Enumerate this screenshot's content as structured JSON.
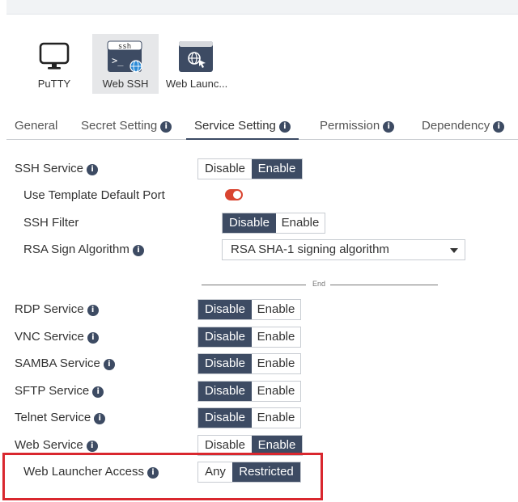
{
  "apps": [
    {
      "label": "PuTTY",
      "icon": "monitor-icon",
      "active": false
    },
    {
      "label": "Web SSH",
      "icon": "ssh-terminal-icon",
      "icon_text": "ssh",
      "active": true
    },
    {
      "label": "Web Launc...",
      "icon": "web-launcher-icon",
      "active": false
    }
  ],
  "tabs": [
    {
      "label": "General",
      "info": false,
      "active": false
    },
    {
      "label": "Secret Setting",
      "info": true,
      "active": false
    },
    {
      "label": "Service Setting",
      "info": true,
      "active": true
    },
    {
      "label": "Permission",
      "info": true,
      "active": false
    },
    {
      "label": "Dependency",
      "info": true,
      "active": false
    }
  ],
  "ssh": {
    "label": "SSH Service",
    "options": [
      "Disable",
      "Enable"
    ],
    "selected": "Enable",
    "template_port": {
      "label": "Use Template Default Port",
      "on": true
    },
    "filter": {
      "label": "SSH Filter",
      "options": [
        "Disable",
        "Enable"
      ],
      "selected": "Disable"
    },
    "rsa": {
      "label": "RSA Sign Algorithm",
      "value": "RSA SHA-1 signing algorithm"
    }
  },
  "divider": "End",
  "services": [
    {
      "label": "RDP Service",
      "options": [
        "Disable",
        "Enable"
      ],
      "selected": "Disable"
    },
    {
      "label": "VNC Service",
      "options": [
        "Disable",
        "Enable"
      ],
      "selected": "Disable"
    },
    {
      "label": "SAMBA Service",
      "options": [
        "Disable",
        "Enable"
      ],
      "selected": "Disable"
    },
    {
      "label": "SFTP Service",
      "options": [
        "Disable",
        "Enable"
      ],
      "selected": "Disable"
    },
    {
      "label": "Telnet Service",
      "options": [
        "Disable",
        "Enable"
      ],
      "selected": "Disable"
    },
    {
      "label": "Web Service",
      "options": [
        "Disable",
        "Enable"
      ],
      "selected": "Enable"
    }
  ],
  "web_launcher_access": {
    "label": "Web Launcher Access",
    "options": [
      "Any",
      "Restricted"
    ],
    "selected": "Restricted"
  },
  "colors": {
    "accent": "#3d4b63",
    "highlight": "#d9272e",
    "toggle_on": "#d94430"
  }
}
